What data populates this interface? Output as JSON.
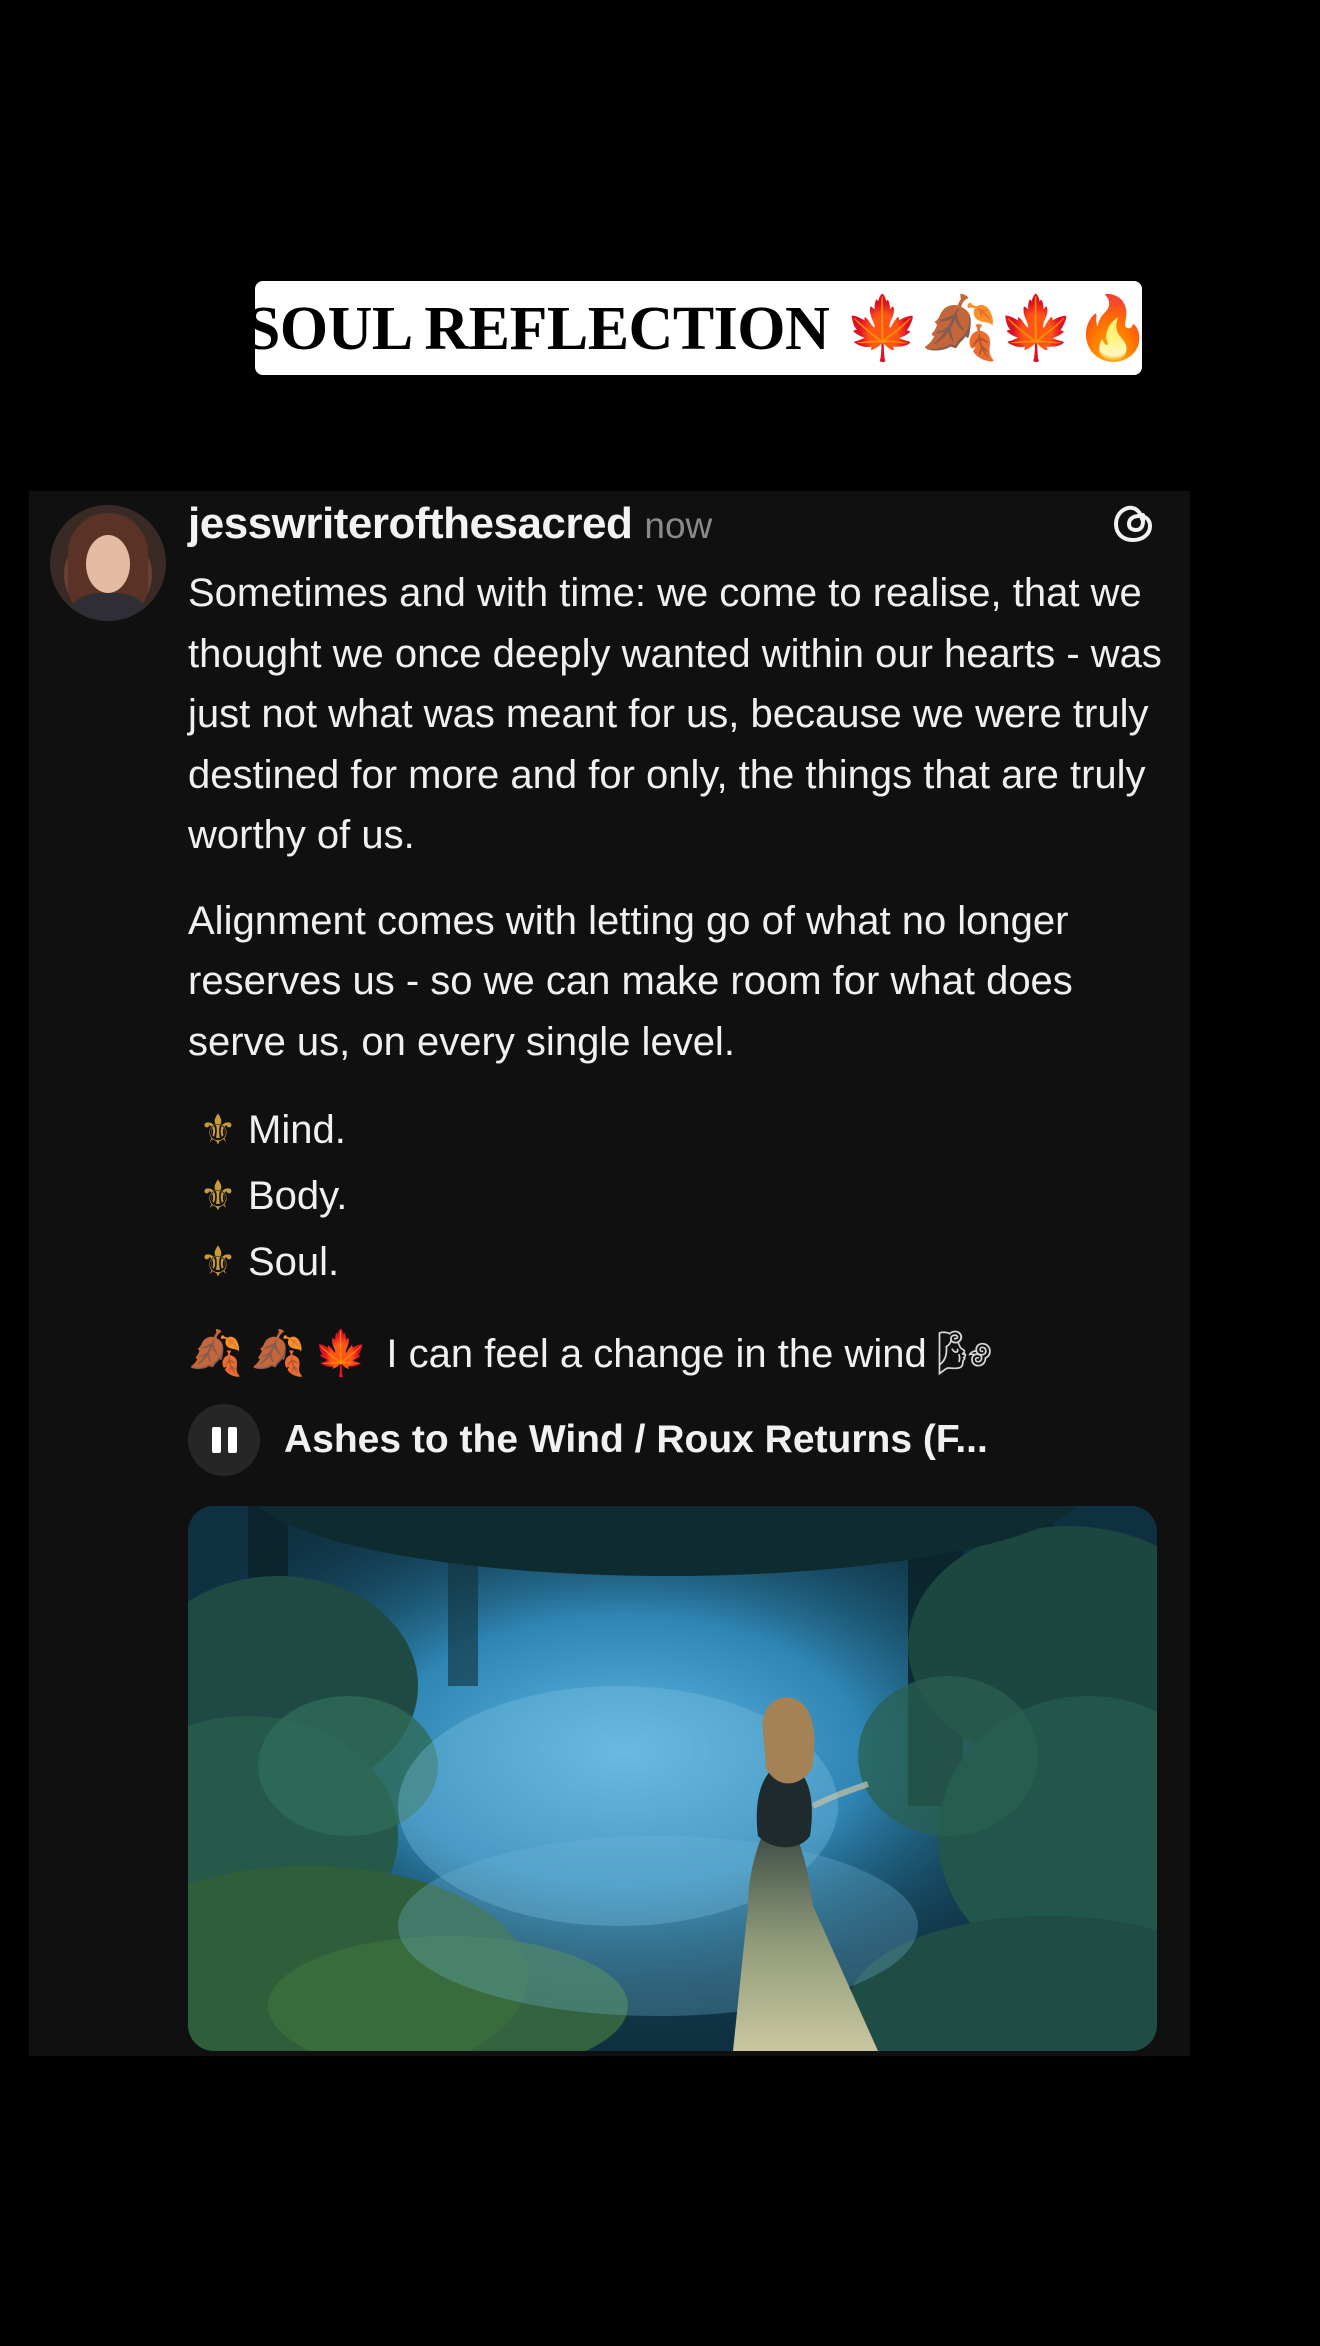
{
  "banner": {
    "title": "SOUL REFLECTION 🍁🍂🍁🔥"
  },
  "post": {
    "username": "jesswriterofthesacred",
    "timestamp": "now",
    "paragraph1": "Sometimes and with time: we come to realise, that we thought we once deeply wanted within our hearts - was just not what was meant for us, because we were truly destined for more and for only, the things that are truly worthy of us.",
    "paragraph2": "Alignment comes with letting go of what no longer reserves us - so we can make room for what does serve us, on every single level.",
    "list": [
      {
        "icon": "fleur-de-lis-icon",
        "symbol": "⚜",
        "label": "Mind."
      },
      {
        "icon": "fleur-de-lis-icon",
        "symbol": "⚜",
        "label": "Body."
      },
      {
        "icon": "fleur-de-lis-icon",
        "symbol": "⚜",
        "label": "Soul."
      }
    ],
    "wind_line": {
      "leading_emojis": [
        "🍂",
        "🍂",
        "🍁"
      ],
      "text": "I can feel a change in the wind",
      "trailing_emoji": "🌬"
    },
    "music": {
      "song_title": "Ashes to the Wind / Roux Returns (F...",
      "state": "playing"
    }
  },
  "icons": {
    "app": "threads-icon",
    "pause": "pause-icon"
  },
  "colors": {
    "background": "#000000",
    "card": "#101010",
    "text": "#f0f0f0",
    "muted": "#8a8a8a",
    "banner": "#ffffff"
  }
}
